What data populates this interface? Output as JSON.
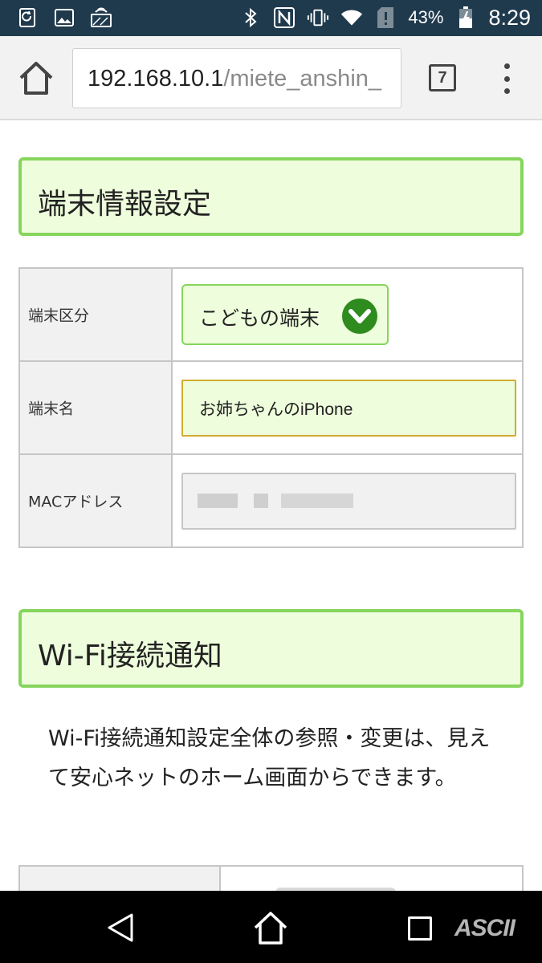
{
  "status_bar": {
    "battery": "43%",
    "time": "8:29",
    "icons": [
      "sync-icon",
      "image-icon",
      "cast-icon",
      "bluetooth-icon",
      "nfc-icon",
      "vibrate-icon",
      "wifi-icon",
      "no-sim-icon",
      "battery-icon"
    ]
  },
  "browser": {
    "url_host": "192.168.10.1",
    "url_path": "/miete_anshin_",
    "tab_count": "7"
  },
  "device_section": {
    "title": "端末情報設定",
    "rows": {
      "type_label": "端末区分",
      "type_value": "こどもの端末",
      "name_label": "端末名",
      "name_value": "お姉ちゃんのiPhone",
      "mac_label": "MACアドレス"
    }
  },
  "wifi_section": {
    "title": "Wi-Fi接続通知",
    "description": "Wi-Fi接続通知設定全体の参照・変更は、見えて安心ネットのホーム画面からできます。"
  },
  "watermark": "ASCII",
  "colors": {
    "accent_green": "#86d55c",
    "header_bg": "#eefedc",
    "chevron_green": "#2e8b1e",
    "input_border": "#d1ac2c",
    "status_bar": "#1f3a4d"
  }
}
